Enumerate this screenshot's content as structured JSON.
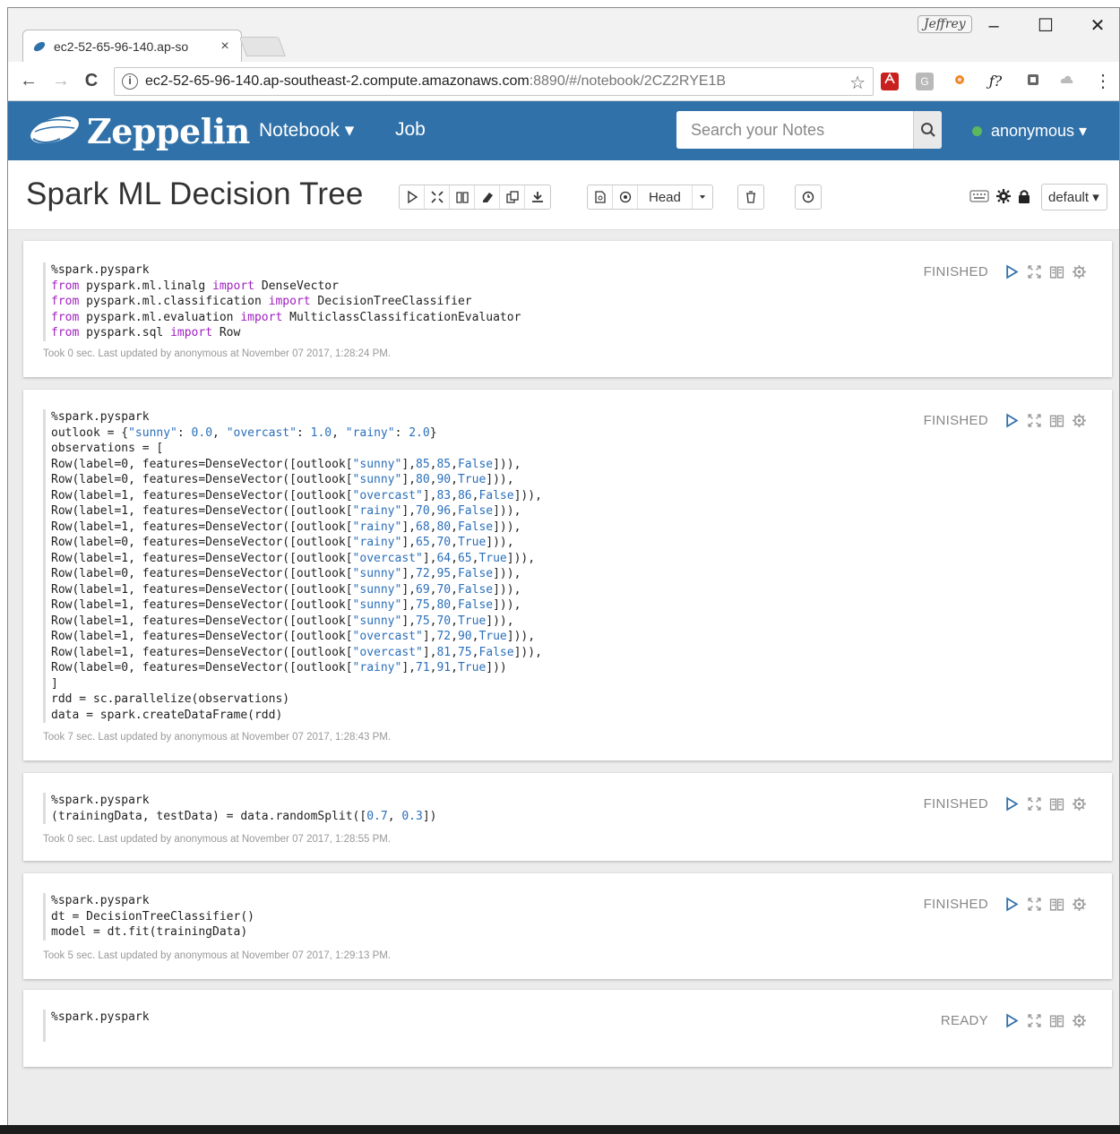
{
  "browser": {
    "tab_title": "ec2-52-65-96-140.ap-so",
    "tab_close": "×",
    "profile_name": "Jeffrey",
    "url_host": "ec2-52-65-96-140.ap-southeast-2.compute.amazonaws.com",
    "url_path": ":8890/#/notebook/2CZ2RYE1B",
    "info_glyph": "i",
    "minimize": "–",
    "maximize": "☐",
    "close": "✕",
    "back": "←",
    "forward": "→",
    "reload": "C",
    "bookmark_star": "☆",
    "ext_fx": "ƒ?",
    "menu": "⋮"
  },
  "navbar": {
    "brand": "Zeppelin",
    "notebook_menu": "Notebook ▾",
    "job_link": "Job",
    "search_placeholder": "Search your Notes",
    "user": "anonymous ▾"
  },
  "note": {
    "title": "Spark ML Decision Tree",
    "head_label": "Head",
    "interpreter_binding": "default ▾"
  },
  "paragraphs": [
    {
      "status": "FINISHED",
      "code": [
        [
          {
            "t": "%spark.pyspark"
          }
        ],
        [
          {
            "t": "from",
            "k": "kw"
          },
          {
            "t": " pyspark.ml.linalg "
          },
          {
            "t": "import",
            "k": "kw"
          },
          {
            "t": " DenseVector"
          }
        ],
        [
          {
            "t": "from",
            "k": "kw"
          },
          {
            "t": " pyspark.ml.classification "
          },
          {
            "t": "import",
            "k": "kw"
          },
          {
            "t": " DecisionTreeClassifier"
          }
        ],
        [
          {
            "t": "from",
            "k": "kw"
          },
          {
            "t": " pyspark.ml.evaluation "
          },
          {
            "t": "import",
            "k": "kw"
          },
          {
            "t": " MulticlassClassificationEvaluator"
          }
        ],
        [
          {
            "t": "from",
            "k": "kw"
          },
          {
            "t": " pyspark.sql "
          },
          {
            "t": "import",
            "k": "kw"
          },
          {
            "t": " Row"
          }
        ]
      ],
      "meta": "Took 0 sec. Last updated by anonymous at November 07 2017, 1:28:24 PM."
    },
    {
      "status": "FINISHED",
      "code": [
        [
          {
            "t": "%spark.pyspark"
          }
        ],
        [
          {
            "t": "outlook = {"
          },
          {
            "t": "\"sunny\"",
            "k": "str"
          },
          {
            "t": ": "
          },
          {
            "t": "0.0",
            "k": "str"
          },
          {
            "t": ", "
          },
          {
            "t": "\"overcast\"",
            "k": "str"
          },
          {
            "t": ": "
          },
          {
            "t": "1.0",
            "k": "str"
          },
          {
            "t": ", "
          },
          {
            "t": "\"rainy\"",
            "k": "str"
          },
          {
            "t": ": "
          },
          {
            "t": "2.0",
            "k": "str"
          },
          {
            "t": "}"
          }
        ],
        [
          {
            "t": "observations = ["
          }
        ],
        [
          {
            "t": "Row(label=0, features=DenseVector([outlook["
          },
          {
            "t": "\"sunny\"",
            "k": "str"
          },
          {
            "t": "],"
          },
          {
            "t": "85",
            "k": "str"
          },
          {
            "t": ","
          },
          {
            "t": "85",
            "k": "str"
          },
          {
            "t": ","
          },
          {
            "t": "False",
            "k": "str"
          },
          {
            "t": "])),"
          }
        ],
        [
          {
            "t": "Row(label=0, features=DenseVector([outlook["
          },
          {
            "t": "\"sunny\"",
            "k": "str"
          },
          {
            "t": "],"
          },
          {
            "t": "80",
            "k": "str"
          },
          {
            "t": ","
          },
          {
            "t": "90",
            "k": "str"
          },
          {
            "t": ","
          },
          {
            "t": "True",
            "k": "str"
          },
          {
            "t": "])),"
          }
        ],
        [
          {
            "t": "Row(label=1, features=DenseVector([outlook["
          },
          {
            "t": "\"overcast\"",
            "k": "str"
          },
          {
            "t": "],"
          },
          {
            "t": "83",
            "k": "str"
          },
          {
            "t": ","
          },
          {
            "t": "86",
            "k": "str"
          },
          {
            "t": ","
          },
          {
            "t": "False",
            "k": "str"
          },
          {
            "t": "])),"
          }
        ],
        [
          {
            "t": "Row(label=1, features=DenseVector([outlook["
          },
          {
            "t": "\"rainy\"",
            "k": "str"
          },
          {
            "t": "],"
          },
          {
            "t": "70",
            "k": "str"
          },
          {
            "t": ","
          },
          {
            "t": "96",
            "k": "str"
          },
          {
            "t": ","
          },
          {
            "t": "False",
            "k": "str"
          },
          {
            "t": "])),"
          }
        ],
        [
          {
            "t": "Row(label=1, features=DenseVector([outlook["
          },
          {
            "t": "\"rainy\"",
            "k": "str"
          },
          {
            "t": "],"
          },
          {
            "t": "68",
            "k": "str"
          },
          {
            "t": ","
          },
          {
            "t": "80",
            "k": "str"
          },
          {
            "t": ","
          },
          {
            "t": "False",
            "k": "str"
          },
          {
            "t": "])),"
          }
        ],
        [
          {
            "t": "Row(label=0, features=DenseVector([outlook["
          },
          {
            "t": "\"rainy\"",
            "k": "str"
          },
          {
            "t": "],"
          },
          {
            "t": "65",
            "k": "str"
          },
          {
            "t": ","
          },
          {
            "t": "70",
            "k": "str"
          },
          {
            "t": ","
          },
          {
            "t": "True",
            "k": "str"
          },
          {
            "t": "])),"
          }
        ],
        [
          {
            "t": "Row(label=1, features=DenseVector([outlook["
          },
          {
            "t": "\"overcast\"",
            "k": "str"
          },
          {
            "t": "],"
          },
          {
            "t": "64",
            "k": "str"
          },
          {
            "t": ","
          },
          {
            "t": "65",
            "k": "str"
          },
          {
            "t": ","
          },
          {
            "t": "True",
            "k": "str"
          },
          {
            "t": "])),"
          }
        ],
        [
          {
            "t": "Row(label=0, features=DenseVector([outlook["
          },
          {
            "t": "\"sunny\"",
            "k": "str"
          },
          {
            "t": "],"
          },
          {
            "t": "72",
            "k": "str"
          },
          {
            "t": ","
          },
          {
            "t": "95",
            "k": "str"
          },
          {
            "t": ","
          },
          {
            "t": "False",
            "k": "str"
          },
          {
            "t": "])),"
          }
        ],
        [
          {
            "t": "Row(label=1, features=DenseVector([outlook["
          },
          {
            "t": "\"sunny\"",
            "k": "str"
          },
          {
            "t": "],"
          },
          {
            "t": "69",
            "k": "str"
          },
          {
            "t": ","
          },
          {
            "t": "70",
            "k": "str"
          },
          {
            "t": ","
          },
          {
            "t": "False",
            "k": "str"
          },
          {
            "t": "])),"
          }
        ],
        [
          {
            "t": "Row(label=1, features=DenseVector([outlook["
          },
          {
            "t": "\"sunny\"",
            "k": "str"
          },
          {
            "t": "],"
          },
          {
            "t": "75",
            "k": "str"
          },
          {
            "t": ","
          },
          {
            "t": "80",
            "k": "str"
          },
          {
            "t": ","
          },
          {
            "t": "False",
            "k": "str"
          },
          {
            "t": "])),"
          }
        ],
        [
          {
            "t": "Row(label=1, features=DenseVector([outlook["
          },
          {
            "t": "\"sunny\"",
            "k": "str"
          },
          {
            "t": "],"
          },
          {
            "t": "75",
            "k": "str"
          },
          {
            "t": ","
          },
          {
            "t": "70",
            "k": "str"
          },
          {
            "t": ","
          },
          {
            "t": "True",
            "k": "str"
          },
          {
            "t": "])),"
          }
        ],
        [
          {
            "t": "Row(label=1, features=DenseVector([outlook["
          },
          {
            "t": "\"overcast\"",
            "k": "str"
          },
          {
            "t": "],"
          },
          {
            "t": "72",
            "k": "str"
          },
          {
            "t": ","
          },
          {
            "t": "90",
            "k": "str"
          },
          {
            "t": ","
          },
          {
            "t": "True",
            "k": "str"
          },
          {
            "t": "])),"
          }
        ],
        [
          {
            "t": "Row(label=1, features=DenseVector([outlook["
          },
          {
            "t": "\"overcast\"",
            "k": "str"
          },
          {
            "t": "],"
          },
          {
            "t": "81",
            "k": "str"
          },
          {
            "t": ","
          },
          {
            "t": "75",
            "k": "str"
          },
          {
            "t": ","
          },
          {
            "t": "False",
            "k": "str"
          },
          {
            "t": "])),"
          }
        ],
        [
          {
            "t": "Row(label=0, features=DenseVector([outlook["
          },
          {
            "t": "\"rainy\"",
            "k": "str"
          },
          {
            "t": "],"
          },
          {
            "t": "71",
            "k": "str"
          },
          {
            "t": ","
          },
          {
            "t": "91",
            "k": "str"
          },
          {
            "t": ","
          },
          {
            "t": "True",
            "k": "str"
          },
          {
            "t": "]))"
          }
        ],
        [
          {
            "t": "]"
          }
        ],
        [
          {
            "t": "rdd = sc.parallelize(observations)"
          }
        ],
        [
          {
            "t": "data = spark.createDataFrame(rdd)"
          }
        ]
      ],
      "meta": "Took 7 sec. Last updated by anonymous at November 07 2017, 1:28:43 PM."
    },
    {
      "status": "FINISHED",
      "code": [
        [
          {
            "t": "%spark.pyspark"
          }
        ],
        [
          {
            "t": "(trainingData, testData) = data.randomSplit(["
          },
          {
            "t": "0.7",
            "k": "str"
          },
          {
            "t": ", "
          },
          {
            "t": "0.3",
            "k": "str"
          },
          {
            "t": "])"
          }
        ]
      ],
      "meta": "Took 0 sec. Last updated by anonymous at November 07 2017, 1:28:55 PM."
    },
    {
      "status": "FINISHED",
      "code": [
        [
          {
            "t": "%spark.pyspark"
          }
        ],
        [
          {
            "t": "dt = DecisionTreeClassifier()"
          }
        ],
        [
          {
            "t": "model = dt.fit(trainingData)"
          }
        ]
      ],
      "meta": "Took 5 sec. Last updated by anonymous at November 07 2017, 1:29:13 PM."
    },
    {
      "status": "READY",
      "code": [
        [
          {
            "t": "%spark.pyspark"
          }
        ]
      ],
      "meta": ""
    }
  ],
  "colors": {
    "navbar": "#3071a9",
    "keyword": "#a020c0",
    "string": "#2a6fba",
    "status_dot": "#5cb85c"
  }
}
